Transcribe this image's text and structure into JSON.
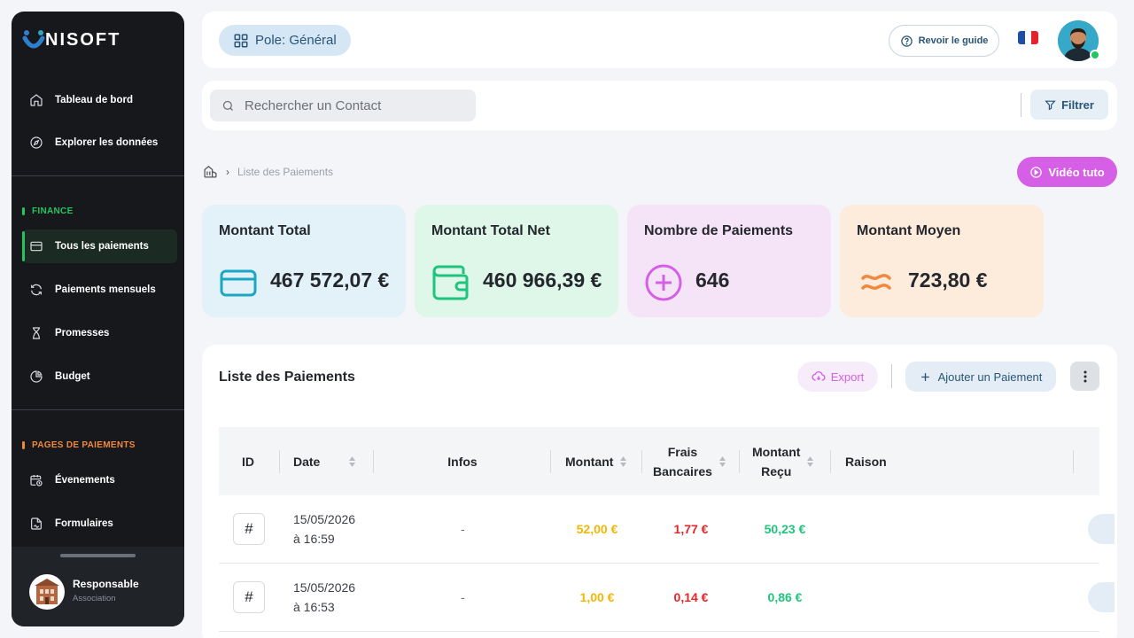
{
  "sidebar": {
    "brand": "NISOFT",
    "nav_top": [
      {
        "label": "Tableau de bord",
        "icon": "home-icon"
      },
      {
        "label": "Explorer les données",
        "icon": "compass-icon"
      }
    ],
    "finance_title": "FINANCE",
    "finance_items": [
      {
        "label": "Tous les paiements",
        "icon": "credit-card-icon",
        "active": true
      },
      {
        "label": "Paiements mensuels",
        "icon": "refresh-icon"
      },
      {
        "label": "Promesses",
        "icon": "hourglass-icon"
      },
      {
        "label": "Budget",
        "icon": "pie-chart-icon"
      }
    ],
    "pages_title": "PAGES DE PAIEMENTS",
    "pages_items": [
      {
        "label": "Évenements",
        "icon": "calendar-clock-icon"
      },
      {
        "label": "Formulaires",
        "icon": "file-signature-icon"
      }
    ],
    "user": {
      "name": "Responsable",
      "role": "Association"
    }
  },
  "header": {
    "pole": "Pole: Général",
    "guide": "Revoir le guide",
    "language": "fr"
  },
  "search": {
    "placeholder": "Rechercher un Contact",
    "filter_label": "Filtrer"
  },
  "breadcrumb": {
    "current": "Liste des Paiements"
  },
  "video_label": "Vidéo tuto",
  "stats": [
    {
      "title": "Montant Total",
      "value": "467 572,07 €",
      "bg": "#e3f1f9",
      "color": "#1ba7c4",
      "icon": "credit-card-icon"
    },
    {
      "title": "Montant Total Net",
      "value": "460 966,39 €",
      "bg": "#def7e9",
      "color": "#1fc47d",
      "icon": "wallet-icon"
    },
    {
      "title": "Nombre de Paiements",
      "value": "646",
      "bg": "#f5e4f8",
      "color": "#d55fe5",
      "icon": "plus-circle-icon"
    },
    {
      "title": "Montant Moyen",
      "value": "723,80 €",
      "bg": "#fdebdc",
      "color": "#f0883e",
      "icon": "approx-icon"
    }
  ],
  "table": {
    "title": "Liste des Paiements",
    "export_label": "Export",
    "add_label": "Ajouter un Paiement",
    "columns": {
      "id": "ID",
      "date": "Date",
      "infos": "Infos",
      "montant": "Montant",
      "frais_1": "Frais",
      "frais_2": "Bancaires",
      "recu_1": "Montant",
      "recu_2": "Reçu",
      "raison": "Raison"
    },
    "rows": [
      {
        "id": "#",
        "date_1": "15/05/2026",
        "date_2": "à 16:59",
        "infos": "-",
        "montant": "52,00 €",
        "frais": "1,77 €",
        "recu": "50,23 €",
        "raison": ""
      },
      {
        "id": "#",
        "date_1": "15/05/2026",
        "date_2": "à 16:53",
        "infos": "-",
        "montant": "1,00 €",
        "frais": "0,14 €",
        "recu": "0,86 €",
        "raison": ""
      }
    ]
  },
  "colors": {
    "montant": "#f2b705",
    "frais": "#e5252a",
    "recu": "#1fc47d",
    "accent": "#d55fe5"
  }
}
